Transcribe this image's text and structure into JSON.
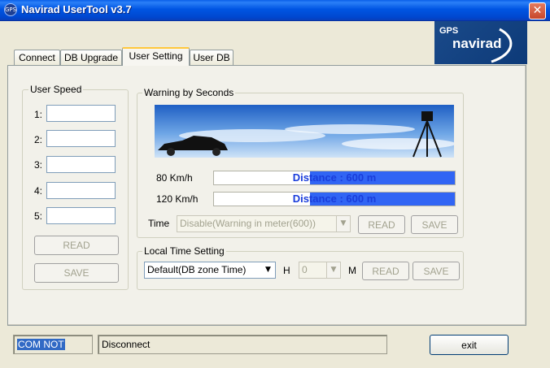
{
  "window": {
    "title": "Navirad UserTool v3.7",
    "close_glyph": "✕",
    "app_icon_text": "GPS"
  },
  "logo": {
    "line1": "GPS",
    "line2": "navirad"
  },
  "tabs": [
    {
      "label": "Connect"
    },
    {
      "label": "DB Upgrade"
    },
    {
      "label": "User Setting",
      "active": true
    },
    {
      "label": "User DB"
    }
  ],
  "user_speed": {
    "title": "User Speed",
    "rows": [
      {
        "label": "1:",
        "value": ""
      },
      {
        "label": "2:",
        "value": ""
      },
      {
        "label": "3:",
        "value": ""
      },
      {
        "label": "4:",
        "value": ""
      },
      {
        "label": "5:",
        "value": ""
      }
    ],
    "read_label": "READ",
    "save_label": "SAVE"
  },
  "warning": {
    "title": "Warning by Seconds",
    "rows": [
      {
        "label": "80 Km/h",
        "text": "Distance : 600 m",
        "fill_fraction": 0.6
      },
      {
        "label": "120 Km/h",
        "text": "Distance : 600 m",
        "fill_fraction": 0.6
      }
    ],
    "time_label": "Time",
    "time_value": "Disable(Warning in meter(600))",
    "read_label": "READ",
    "save_label": "SAVE"
  },
  "local_time": {
    "title": "Local Time Setting",
    "zone_value": "Default(DB zone Time)",
    "h_label": "H",
    "hour_value": "0",
    "m_label": "M",
    "read_label": "READ",
    "save_label": "SAVE"
  },
  "status": {
    "com": "COM NOT",
    "connection": "Disconnect"
  },
  "exit_label": "exit",
  "colors": {
    "accent": "#3165f4",
    "title_bar": "#0055e3",
    "logo_bg": "#1a4a8a"
  },
  "icons": {
    "combo_arrow": "▼"
  }
}
